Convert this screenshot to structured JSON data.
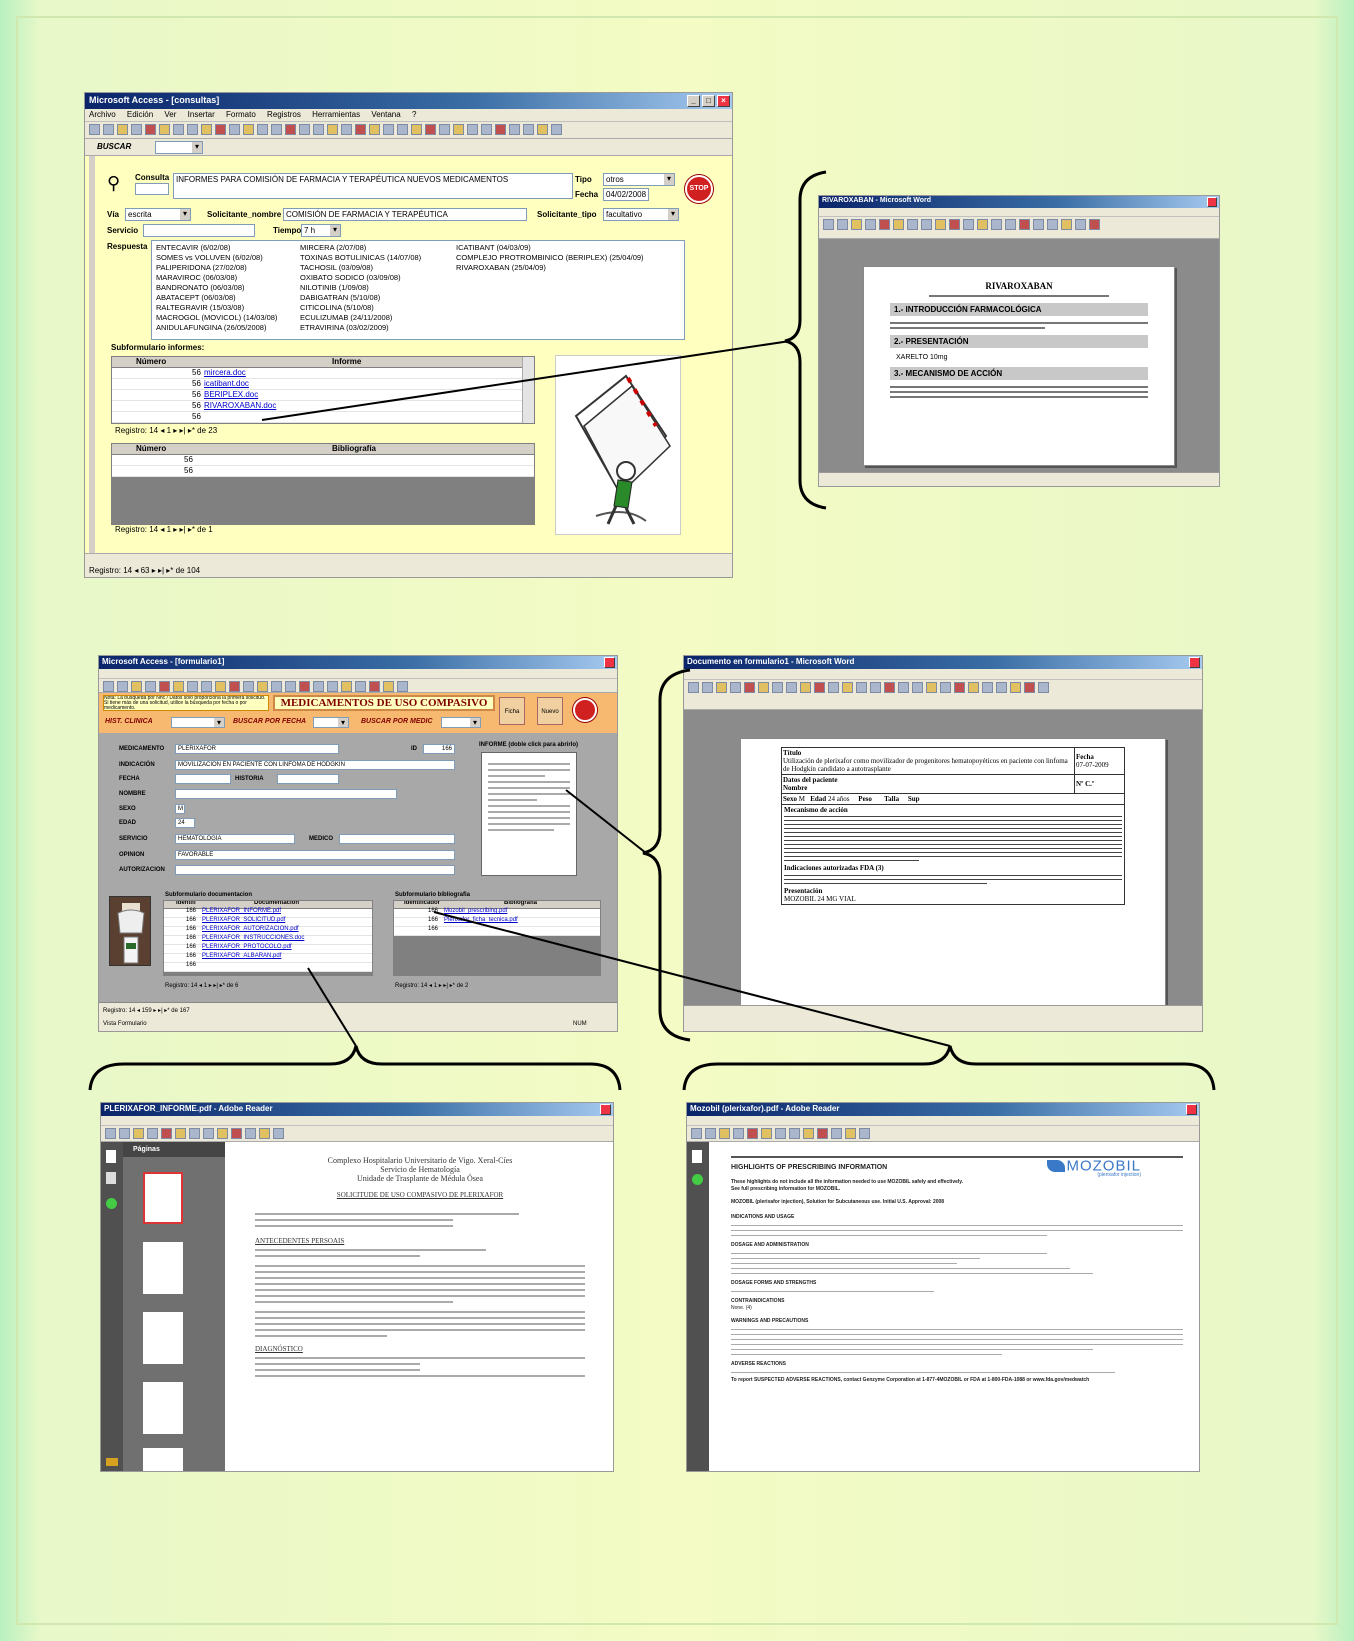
{
  "access1": {
    "title": "Microsoft Access - [consultas]",
    "menu": [
      "Archivo",
      "Edición",
      "Ver",
      "Insertar",
      "Formato",
      "Registros",
      "Herramientas",
      "Ventana",
      "?"
    ],
    "buscar_label": "BUSCAR",
    "consulta_label": "Consulta",
    "consulta_value": "INFORMES PARA COMISIÓN DE FARMACIA Y TERAPÉUTICA NUEVOS MEDICAMENTOS",
    "tipo_label": "Tipo",
    "tipo_value": "otros",
    "fecha_label": "Fecha",
    "fecha_value": "04/02/2008",
    "stop": "STOP",
    "via_label": "Vía",
    "via_value": "escrita",
    "solicitante_nombre_label": "Solicitante_nombre",
    "solicitante_nombre_value": "COMISIÓN DE FARMACIA Y TERAPÉUTICA",
    "solicitante_tipo_label": "Solicitante_tipo",
    "solicitante_tipo_value": "facultativo",
    "servicio_label": "Servicio",
    "tiempo_label": "Tiempo",
    "tiempo_value": "7 h",
    "respuesta_label": "Respuesta",
    "respuesta_col1": [
      "ENTECAVIR (6/02/08)",
      "SOMES vs VOLUVEN (6/02/08)",
      "PALIPERIDONA (27/02/08)",
      "MARAVIROC (06/03/08)",
      "BANDRONATO (06/03/08)",
      "ABATACEPT (06/03/08)",
      "RALTEGRAVIR (15/03/08)",
      "MACROGOL (MOVICOL) (14/03/08)",
      "ANIDULAFUNGINA (26/05/2008)"
    ],
    "respuesta_col2": [
      "MIRCERA (2/07/08)",
      "TOXINAS BOTULINICAS (14/07/08)",
      "TACHOSIL (03/09/08)",
      "OXIBATO SODICO (03/09/08)",
      "NILOTINIB (1/09/08)",
      "DABIGATRAN (5/10/08)",
      "CITICOLINA (5/10/08)",
      "ECULIZUMAB (24/11/2008)",
      "ETRAVIRINA (03/02/2009)"
    ],
    "respuesta_col3": [
      "ICATIBANT (04/03/09)",
      "COMPLEJO PROTROMBINICO (BERIPLEX) (25/04/09)",
      "RIVAROXABAN (25/04/09)"
    ],
    "subform_informes_label": "Subformulario informes:",
    "informes_headers": [
      "Número",
      "Informe"
    ],
    "informes_rows": [
      {
        "num": "56",
        "file": "mircera.doc"
      },
      {
        "num": "56",
        "file": "icatibant.doc"
      },
      {
        "num": "56",
        "file": "BERIPLEX.doc"
      },
      {
        "num": "56",
        "file": "RIVAROXABAN.doc"
      },
      {
        "num": "56",
        "file": ""
      }
    ],
    "nav_informes": "Registro: 14 ◂  1  ▸ ▸| ▸* de 23",
    "biblio_headers": [
      "Número",
      "Bibliografía"
    ],
    "biblio_rows": [
      "56",
      "56"
    ],
    "nav_biblio": "Registro: 14 ◂  1  ▸ ▸| ▸* de 1",
    "nav_main": "Registro: 14 ◂  63  ▸ ▸| ▸* de 104"
  },
  "word1": {
    "title": "RIVAROXABAN - Microsoft Word",
    "doc_title": "RIVAROXABAN",
    "sec1": "1.- INTRODUCCIÓN FARMACOLÓGICA",
    "sec2": "2.- PRESENTACIÓN",
    "sec2_text": "XARELTO 10mg",
    "sec3": "3.- MECANISMO DE ACCIÓN"
  },
  "access2": {
    "title": "Microsoft Access - [formulario1]",
    "banner": "MEDICAMENTOS DE USO COMPASIVO",
    "hint": "Nota: La búsqueda por Nhc / Datos solo proporciona la primera solicitud. Si tiene más de una solicitud, utilice la búsqueda por fecha o por medicamento.",
    "hist_label": "HIST. CLINICA",
    "buscar_fecha": "BUSCAR POR FECHA",
    "buscar_medic": "BUSCAR POR MEDIC",
    "btn_ficha": "Ficha",
    "btn_nuevo": "Nuevo",
    "medicamento_label": "MEDICAMENTO",
    "medicamento_value": "PLERIXAFOR",
    "id_label": "ID",
    "id_value": "166",
    "indicacion_label": "INDICACIÓN",
    "indicacion_value": "MOVILIZACIÓN EN PACIENTE CON LINFOMA DE HODGKIN",
    "fecha_label": "FECHA",
    "historia_label": "HISTORIA",
    "nombre_label": "NOMBRE",
    "sexo_label": "SEXO",
    "sexo_value": "M",
    "edad_label": "EDAD",
    "edad_value": "24",
    "servicio_label": "SERVICIO",
    "servicio_value": "HEMATOLOGÍA",
    "medico_label": "MEDICO",
    "opinion_label": "OPINION",
    "opinion_value": "FAVORABLE",
    "autorizacion_label": "AUTORIZACION",
    "informe_label": "INFORME (doble click para abrirlo)",
    "subdoc_label": "Subformulario documentacion",
    "subdoc_headers": [
      "Identifi",
      "Documentacion"
    ],
    "subdoc_rows": [
      {
        "id": "166",
        "file": "PLERIXAFOR_INFORME.pdf"
      },
      {
        "id": "166",
        "file": "PLERIXAFOR_SOLICITUD.pdf"
      },
      {
        "id": "166",
        "file": "PLERIXAFOR_AUTORIZACION.pdf"
      },
      {
        "id": "166",
        "file": "PLERIXAFOR_INSTRUCCIONES.doc"
      },
      {
        "id": "166",
        "file": "PLERIXAFOR_PROTOCOLO.pdf"
      },
      {
        "id": "166",
        "file": "PLERIXAFOR_ALBARAN.pdf"
      },
      {
        "id": "166",
        "file": ""
      }
    ],
    "subbib_label": "Subformulario bibliografia",
    "subbib_headers": [
      "Identificador",
      "Bibliografia"
    ],
    "subbib_rows": [
      {
        "id": "166",
        "file": "Mozobil_prescribing.pdf"
      },
      {
        "id": "166",
        "file": "Plerixafor_ficha_tecnica.pdf"
      },
      {
        "id": "166",
        "file": ""
      }
    ],
    "nav_doc": "Registro: 14 ◂  1  ▸ ▸| ▸* de 6",
    "nav_bib": "Registro: 14 ◂  1  ▸ ▸| ▸* de 2",
    "nav_main": "Registro: 14 ◂  159  ▸ ▸| ▸* de 167",
    "status": "Vista Formulario",
    "status2": "NUM"
  },
  "word2": {
    "title": "Documento en formulario1 - Microsoft Word",
    "t_titulo": "Título",
    "t_titulo_text": "Utilización de plerixafor como movilizador de progenitores hematopoyéticos en paciente con linfoma de Hodgkin candidato a autotrasplante",
    "t_fecha": "Fecha",
    "t_fecha_value": "07-07-2009",
    "t_datos": "Datos del paciente",
    "t_nombre": "Nombre",
    "t_nhc": "Nº C.º",
    "t_sexo": "Sexo",
    "t_sexo_value": "M",
    "t_edad": "Edad",
    "t_edad_value": "24 años",
    "t_peso": "Peso",
    "t_talla": "Talla",
    "t_sup": "Sup",
    "t_mec": "Mecanismo de acción",
    "t_ind": "Indicaciones autorizadas FDA (3)",
    "t_pres": "Presentación",
    "t_pres_value": "MOZOBIL 24 MG VIAL"
  },
  "pdf1": {
    "title": "PLERIXAFOR_INFORME.pdf - Adobe Reader",
    "panel": "Páginas",
    "h1": "Complexo Hospitalario Universitario de Vigo. Xeral-Cíes",
    "h2": "Servicio de Hematología",
    "h3": "Unidade de Trasplante de Médula Ósea",
    "h4": "SOLICITUDE DE USO COMPASIVO DE PLERIXAFOR",
    "antecedentes": "ANTECEDENTES PERSOAIS",
    "diagnostico": "DIAGNÓSTICO"
  },
  "pdf2": {
    "title": "Mozobil (plerixafor).pdf - Adobe Reader",
    "heading": "HIGHLIGHTS OF PRESCRIBING INFORMATION",
    "logo": "MOZOBIL",
    "logo_sub": "(plerixafor injection)",
    "sub1": "These highlights do not include all the information needed to use MOZOBIL safely and effectively. See full prescribing information for MOZOBIL.",
    "sub2": "MOZOBIL (plerixafor injection), Solution for Subcutaneous use. Initial U.S. Approval: 2008",
    "s_ind": "INDICATIONS AND USAGE",
    "s_dos": "DOSAGE AND ADMINISTRATION",
    "s_forms": "DOSAGE FORMS AND STRENGTHS",
    "s_contra": "CONTRAINDICATIONS",
    "s_contra_text": "None. (4)",
    "s_warn": "WARNINGS AND PRECAUTIONS",
    "s_adv": "ADVERSE REACTIONS",
    "s_report": "To report SUSPECTED ADVERSE REACTIONS, contact Genzyme Corporation at 1-877-4MOZOBIL or FDA at 1-800-FDA-1088 or www.fda.gov/medwatch"
  }
}
